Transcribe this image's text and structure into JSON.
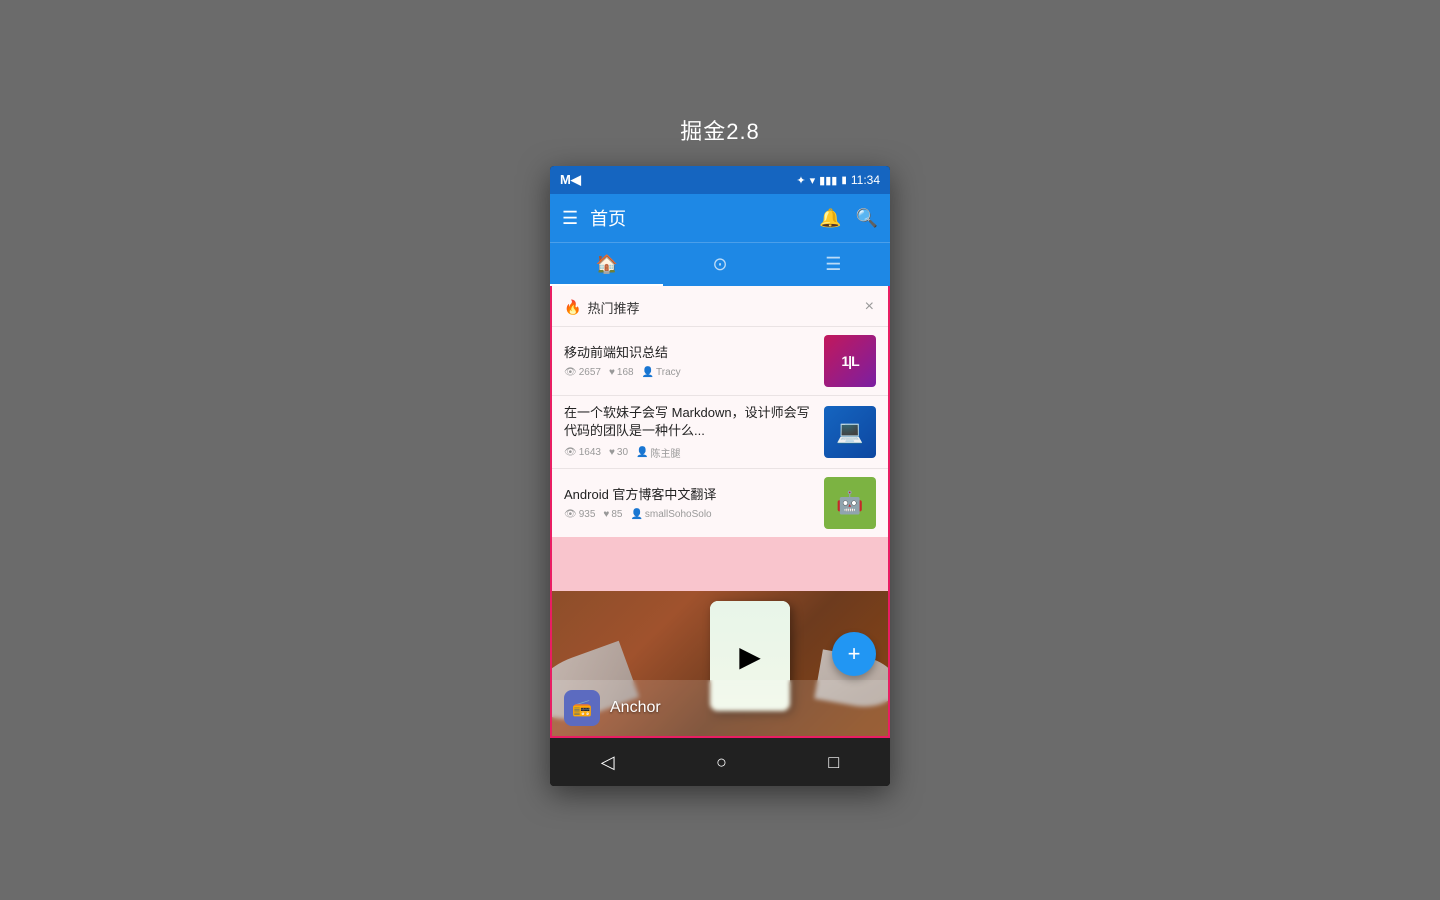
{
  "page": {
    "title": "掘金2.8"
  },
  "status_bar": {
    "time": "11:34",
    "icons": [
      "bluetooth",
      "wifi",
      "signal",
      "battery"
    ]
  },
  "app_bar": {
    "title": "首页",
    "menu_icon": "≡",
    "bell_icon": "🔔",
    "search_icon": "🔍"
  },
  "tabs": [
    {
      "icon": "🏠",
      "active": true
    },
    {
      "icon": "◎",
      "active": false
    },
    {
      "icon": "☰",
      "active": false
    }
  ],
  "hot_section": {
    "title": "热门推荐",
    "close_btn": "×"
  },
  "articles": [
    {
      "title": "移动前端知识总结",
      "views": "2657",
      "likes": "168",
      "author": "Tracy",
      "thumb_text": "1|L",
      "thumb_class": "thumb-1"
    },
    {
      "title": "在一个软妹子会写 Markdown，设计师会写代码的团队是一种什么...",
      "views": "1643",
      "likes": "30",
      "author": "陈主腿",
      "thumb_text": "💻",
      "thumb_class": "thumb-2"
    },
    {
      "title": "Android 官方博客中文翻译",
      "views": "935",
      "likes": "85",
      "author": "smallSohoSolo",
      "thumb_text": "🤖",
      "thumb_class": "thumb-3"
    }
  ],
  "anchor": {
    "name": "Anchor",
    "logo_icon": "📻"
  },
  "fab": {
    "icon": "+"
  },
  "nav_bar": {
    "back": "◁",
    "home": "○",
    "recent": "□"
  }
}
